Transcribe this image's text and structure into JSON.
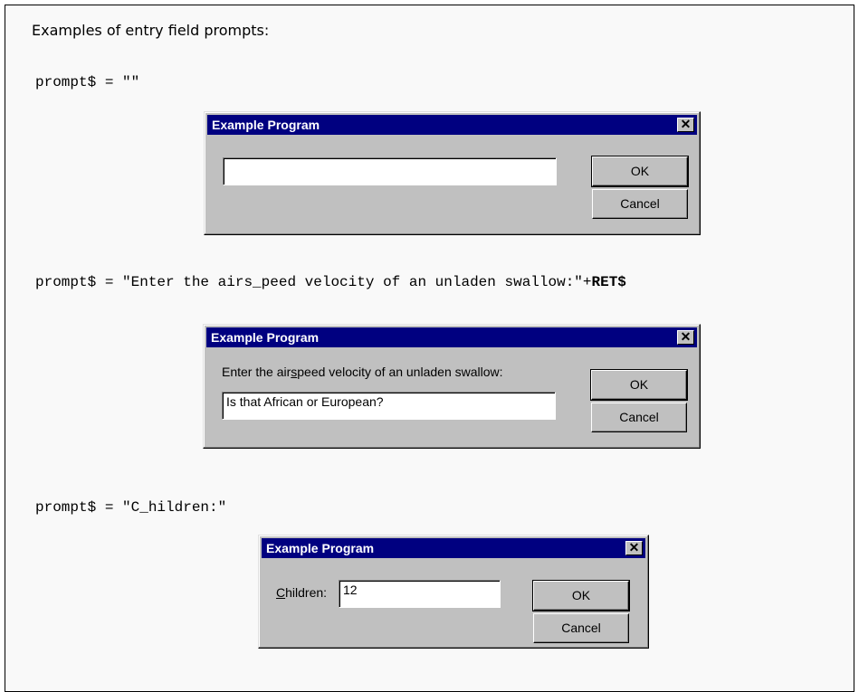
{
  "heading": "Examples of entry field prompts:",
  "examples": [
    {
      "code": "prompt$ = \"\"",
      "dialog": {
        "title": "Example Program",
        "input_value": "",
        "ok_label": "OK",
        "cancel_label": "Cancel"
      }
    },
    {
      "code_prefix": "prompt$ = \"Enter the airs_peed velocity of an unladen swallow:\"+",
      "code_bold": "RET$",
      "dialog": {
        "title": "Example Program",
        "prompt_before": "Enter the air",
        "prompt_underlined": "s",
        "prompt_after": "peed velocity of an unladen swallow:",
        "input_value": "Is that African or European?",
        "ok_label": "OK",
        "cancel_label": "Cancel"
      }
    },
    {
      "code": "prompt$ = \"C_hildren:\"",
      "dialog": {
        "title": "Example Program",
        "label_underlined": "C",
        "label_rest": "hildren:",
        "input_value": "12",
        "ok_label": "OK",
        "cancel_label": "Cancel"
      }
    }
  ],
  "close_glyph": "✕",
  "icons": {
    "close": "close-icon"
  }
}
